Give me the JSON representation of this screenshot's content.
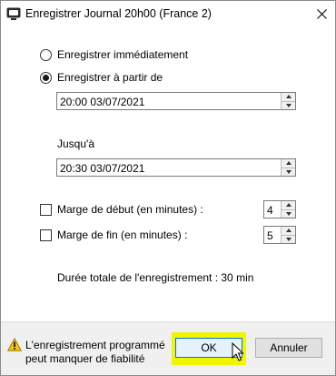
{
  "window": {
    "title": "Enregistrer Journal 20h00 (France 2)"
  },
  "options": {
    "record_now_label": "Enregistrer immédiatement",
    "record_from_label": "Enregistrer à partir de",
    "selected": "record_from"
  },
  "start": {
    "value": "20:00 03/07/2021"
  },
  "end": {
    "label": "Jusqu'à",
    "value": "20:30 03/07/2021"
  },
  "margins": {
    "start_label": "Marge de début (en minutes) :",
    "start_value": "4",
    "start_checked": false,
    "end_label": "Marge de fin (en minutes) :",
    "end_value": "5",
    "end_checked": false
  },
  "duration_text": "Durée totale de l'enregistrement : 30 min",
  "footer": {
    "warning_line1": "L'enregistrement programmé",
    "warning_line2": "peut manquer de fiabilité",
    "ok_label": "OK",
    "cancel_label": "Annuler"
  },
  "colors": {
    "highlight": "#f1f500",
    "ok_border": "#0078d7",
    "warning": "#f5c400"
  }
}
